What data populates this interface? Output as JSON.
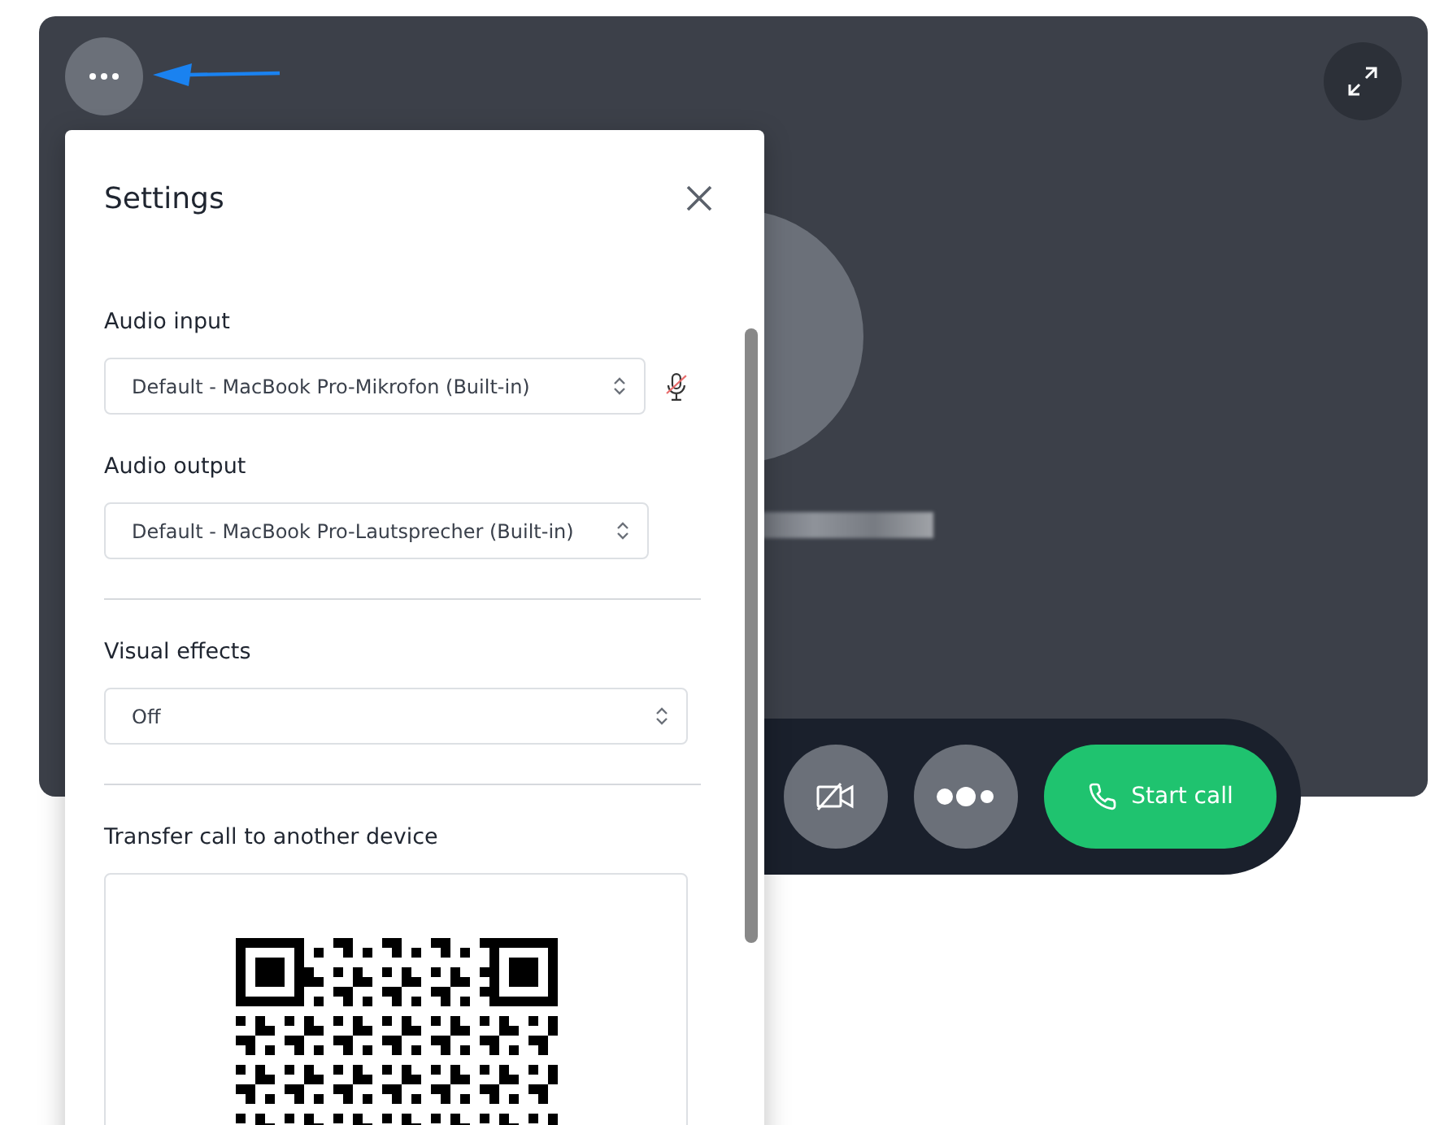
{
  "settings": {
    "title": "Settings",
    "sections": [
      {
        "kind": "device_select",
        "label": "Audio input",
        "value": "Default - MacBook Pro-Mikrofon (Built-in)",
        "mic_muted": true
      },
      {
        "kind": "device_select",
        "label": "Audio output",
        "value": "Default - MacBook Pro-Lautsprecher (Built-in)"
      },
      {
        "kind": "divider"
      },
      {
        "kind": "wide_select",
        "label": "Visual effects",
        "value": "Off"
      },
      {
        "kind": "divider"
      },
      {
        "kind": "qr",
        "label": "Transfer call to another device"
      }
    ]
  },
  "call_controls": {
    "video_off": true,
    "start_call": "Start call"
  }
}
